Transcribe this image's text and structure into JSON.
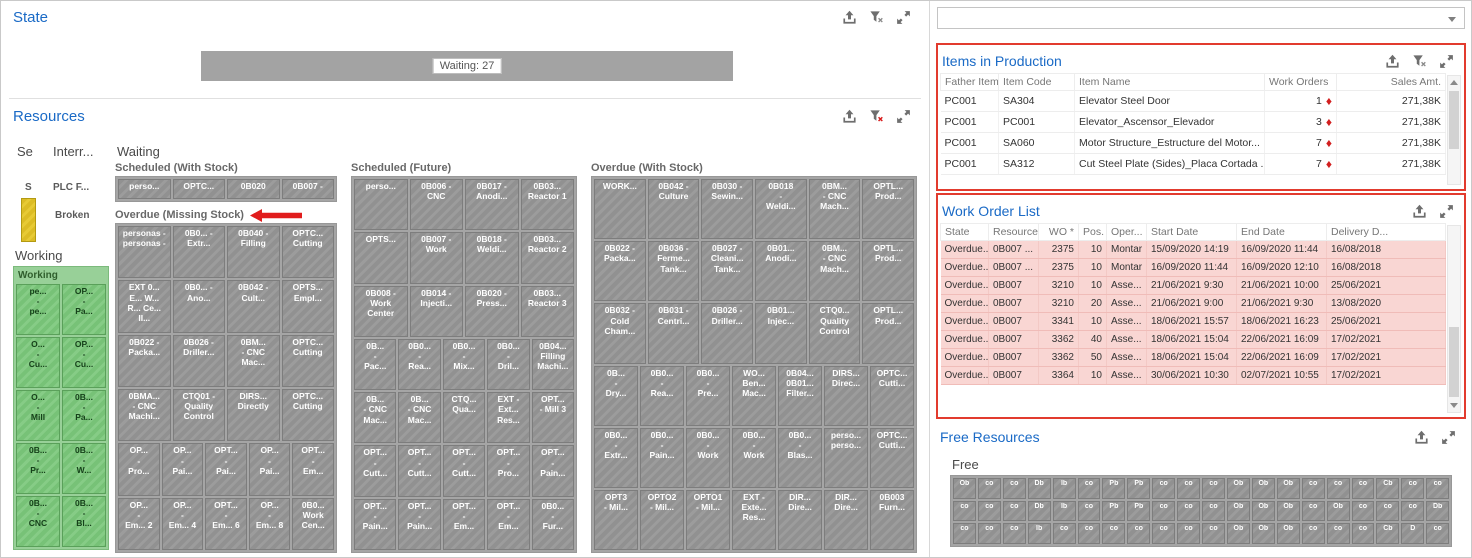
{
  "state_panel": {
    "title": "State",
    "icons": [
      "export-icon",
      "clear-filter-icon",
      "maximize-icon"
    ],
    "bar": {
      "label": "Waiting: 27",
      "status": "Waiting",
      "value": 27,
      "color": "#a3a3a3"
    }
  },
  "resources_panel": {
    "title": "Resources",
    "icons": [
      "export-icon",
      "clear-filter-red-icon",
      "maximize-icon"
    ],
    "section_labels": {
      "selected": "Se",
      "interrupted": "Interr...",
      "waiting": "Waiting",
      "working": "Working"
    },
    "selected_group": {
      "header": "S",
      "tile_color": "#e3c52a"
    },
    "interrupted_group": {
      "items": [
        "PLC F...",
        "Broken"
      ]
    },
    "working_group": {
      "label": "Working",
      "tile_rows": [
        [
          [
            "pe...",
            "-",
            "pe..."
          ],
          [
            "OP...",
            "-",
            "Pa..."
          ]
        ],
        [
          [
            "O...",
            "-",
            "Cu..."
          ],
          [
            "OP...",
            "-",
            "Cu..."
          ]
        ],
        [
          [
            "O...",
            "-",
            "Mill"
          ],
          [
            "0B...",
            "-",
            "Pa..."
          ]
        ],
        [
          [
            "0B...",
            "-",
            "Pr..."
          ],
          [
            "0B...",
            "-",
            "W..."
          ]
        ],
        [
          [
            "0B...",
            "-",
            "CNC"
          ],
          [
            "0B...",
            "-",
            "Bl..."
          ]
        ]
      ]
    },
    "waiting_groups": {
      "scheduled_with_stock": {
        "title": "Scheduled (With Stock)",
        "tile_rows": [
          [
            [
              "perso..."
            ],
            [
              "OPTC..."
            ],
            [
              "0B020"
            ],
            [
              "0B007 -"
            ]
          ]
        ]
      },
      "overdue_missing_stock": {
        "title": "Overdue (Missing Stock)",
        "tile_rows": [
          [
            [
              "personas -",
              "personas -"
            ],
            [
              "0B0... -",
              "Extr..."
            ],
            [
              "0B040 -",
              "Filling"
            ],
            [
              "OPTC...",
              "Cutting"
            ]
          ],
          [
            [
              "EXT 0...",
              "E... W...",
              "R... Ce...",
              "II..."
            ],
            [
              "0B0... -",
              "Ano..."
            ],
            [
              "0B042 -",
              "Cult..."
            ],
            [
              "OPTS...",
              "Empl..."
            ]
          ],
          [
            [
              "0B022 -",
              "Packa..."
            ],
            [
              "0B026 -",
              "Driller..."
            ],
            [
              "0BM...",
              "- CNC",
              "Mac..."
            ],
            [
              "OPTC...",
              "Cutting"
            ]
          ],
          [
            [
              "0BMA...",
              "- CNC",
              "Machi..."
            ],
            [
              "CTQ01 -",
              "Quality",
              "Control"
            ],
            [
              "DIRS...",
              "Directly"
            ],
            [
              "OPTC...",
              "Cutting"
            ]
          ],
          [
            [
              "OP...",
              "-",
              "Pro..."
            ],
            [
              "OP...",
              "-",
              "Pai..."
            ],
            [
              "OPT...",
              "-",
              "Pai..."
            ],
            [
              "OP...",
              "-",
              "Pai..."
            ],
            [
              "OPT...",
              "-",
              "Em..."
            ]
          ],
          [
            [
              "OP...",
              "-",
              "Em... 2"
            ],
            [
              "OP...",
              "-",
              "Em... 4"
            ],
            [
              "OPT...",
              "-",
              "Em... 6"
            ],
            [
              "OP...",
              "-",
              "Em... 8"
            ],
            [
              "0B0...",
              "Work",
              "Cen..."
            ]
          ]
        ]
      },
      "scheduled_future": {
        "title": "Scheduled (Future)",
        "tile_rows": [
          [
            [
              "perso..."
            ],
            [
              "0B006 -",
              "CNC"
            ],
            [
              "0B017 -",
              "Anodi..."
            ],
            [
              "0B03...",
              "Reactor 1"
            ]
          ],
          [
            [
              "OPTS..."
            ],
            [
              "0B007 -",
              "Work"
            ],
            [
              "0B018 -",
              "Weldi..."
            ],
            [
              "0B03...",
              "Reactor 2"
            ]
          ],
          [
            [
              "0B008 -",
              "Work",
              "Center"
            ],
            [
              "0B014 -",
              "Injecti..."
            ],
            [
              "0B020 -",
              "Press..."
            ],
            [
              "0B03...",
              "Reactor 3"
            ]
          ],
          [
            [
              "0B...",
              "-",
              "Pac..."
            ],
            [
              "0B0...",
              "-",
              "Rea..."
            ],
            [
              "0B0...",
              "-",
              "Mix..."
            ],
            [
              "0B0...",
              "-",
              "Dril..."
            ],
            [
              "0B04...",
              "Filling",
              "Machi..."
            ]
          ],
          [
            [
              "0B...",
              "- CNC",
              "Mac..."
            ],
            [
              "0B...",
              "- CNC",
              "Mac..."
            ],
            [
              "CTQ...",
              "Qua..."
            ],
            [
              "EXT -",
              "Ext...",
              "Res..."
            ],
            [
              "OPT...",
              "- Mill 3"
            ]
          ],
          [
            [
              "OPT...",
              "-",
              "Cutt..."
            ],
            [
              "OPT...",
              "-",
              "Cutt..."
            ],
            [
              "OPT...",
              "-",
              "Cutt..."
            ],
            [
              "OPT...",
              "-",
              "Pro..."
            ],
            [
              "OPT...",
              "-",
              "Pain..."
            ]
          ],
          [
            [
              "OPT...",
              "-",
              "Pain..."
            ],
            [
              "OPT...",
              "-",
              "Pain..."
            ],
            [
              "OPT...",
              "-",
              "Em..."
            ],
            [
              "OPT...",
              "-",
              "Em..."
            ],
            [
              "0B0...",
              "-",
              "Fur..."
            ]
          ]
        ]
      },
      "overdue_with_stock": {
        "title": "Overdue (With Stock)",
        "tile_rows": [
          [
            [
              "WORK..."
            ],
            [
              "0B042 -",
              "Culture"
            ],
            [
              "0B030 -",
              "Sewin..."
            ],
            [
              "0B018",
              "-",
              "Weldi..."
            ],
            [
              "0BM...",
              "- CNC",
              "Mach..."
            ],
            [
              "OPTL...",
              "Prod..."
            ]
          ],
          [
            [
              "0B022 -",
              "Packa..."
            ],
            [
              "0B036 -",
              "Ferme...",
              "Tank..."
            ],
            [
              "0B027 -",
              "Cleani...",
              "Tank..."
            ],
            [
              "0B01...",
              "Anodi..."
            ],
            [
              "0BM...",
              "- CNC",
              "Mach..."
            ],
            [
              "OPTL...",
              "Prod..."
            ]
          ],
          [
            [
              "0B032 -",
              "Cold",
              "Cham..."
            ],
            [
              "0B031 -",
              "Centri..."
            ],
            [
              "0B026 -",
              "Driller..."
            ],
            [
              "0B01...",
              "Injec..."
            ],
            [
              "CTQ0...",
              "Quality",
              "Control"
            ],
            [
              "OPTL...",
              "Prod..."
            ]
          ],
          [
            [
              "0B...",
              "-",
              "Dry..."
            ],
            [
              "0B0...",
              "-",
              "Rea..."
            ],
            [
              "0B0...",
              "-",
              "Pre..."
            ],
            [
              "WO...",
              "Ben...",
              "Mac..."
            ],
            [
              "0B04...",
              "0B01...",
              "Filter..."
            ],
            [
              "DIRS...",
              "Direc..."
            ],
            [
              "OPTC...",
              "Cutti..."
            ]
          ],
          [
            [
              "0B0...",
              "-",
              "Extr..."
            ],
            [
              "0B0...",
              "-",
              "Pain..."
            ],
            [
              "0B0...",
              "-",
              "Work"
            ],
            [
              "0B0...",
              "-",
              "Work"
            ],
            [
              "0B0...",
              "-",
              "Blas..."
            ],
            [
              "perso...",
              "perso..."
            ],
            [
              "OPTC...",
              "Cutti..."
            ]
          ],
          [
            [
              "OPT3",
              "- Mil..."
            ],
            [
              "OPTO2",
              "- Mil..."
            ],
            [
              "OPTO1",
              "- Mil..."
            ],
            [
              "EXT -",
              "Exte...",
              "Res..."
            ],
            [
              "DIR...",
              "Dire..."
            ],
            [
              "DIR...",
              "Dire..."
            ],
            [
              "0B003",
              "Furn..."
            ]
          ]
        ]
      }
    }
  },
  "filter_dropdown": {
    "value": ""
  },
  "items_in_production": {
    "title": "Items in Production",
    "icons": [
      "export-icon",
      "clear-filter-icon",
      "maximize-icon"
    ],
    "columns": [
      "Father Item",
      "Item Code",
      "Item Name",
      "Work Orders",
      "Sales Amt."
    ],
    "rows": [
      [
        "PC001",
        "SA304",
        "Elevator Steel Door",
        "1",
        "271,38K"
      ],
      [
        "PC001",
        "PC001",
        "Elevator_Ascensor_Elevador",
        "3",
        "271,38K"
      ],
      [
        "PC001",
        "SA060",
        "Motor Structure_Estructure del Motor...",
        "7",
        "271,38K"
      ],
      [
        "PC001",
        "SA312",
        "Cut Steel Plate (Sides)_Placa Cortada ...",
        "7",
        "271,38K"
      ]
    ],
    "indicator_color": "#d21f1f"
  },
  "work_order_list": {
    "title": "Work Order List",
    "icons": [
      "export-icon",
      "maximize-icon"
    ],
    "columns": [
      "State",
      "Resource",
      "WO *",
      "Pos.",
      "Oper...",
      "Start Date",
      "End Date",
      "Delivery D..."
    ],
    "rows": [
      [
        "Overdue...",
        "0B007 ...",
        "2375",
        "10",
        "Montar",
        "15/09/2020 14:19",
        "16/09/2020 11:44",
        "16/08/2018"
      ],
      [
        "Overdue...",
        "0B007 ...",
        "2375",
        "10",
        "Montar",
        "16/09/2020 11:44",
        "16/09/2020 12:10",
        "16/08/2018"
      ],
      [
        "Overdue...",
        "0B007",
        "3210",
        "10",
        "Asse...",
        "21/06/2021 9:30",
        "21/06/2021 10:00",
        "25/06/2021"
      ],
      [
        "Overdue...",
        "0B007",
        "3210",
        "20",
        "Asse...",
        "21/06/2021 9:00",
        "21/06/2021 9:30",
        "13/08/2020"
      ],
      [
        "Overdue...",
        "0B007",
        "3341",
        "10",
        "Asse...",
        "18/06/2021 15:57",
        "18/06/2021 16:23",
        "25/06/2021"
      ],
      [
        "Overdue...",
        "0B007",
        "3362",
        "40",
        "Asse...",
        "18/06/2021 15:04",
        "22/06/2021 16:09",
        "17/02/2021"
      ],
      [
        "Overdue...",
        "0B007",
        "3362",
        "50",
        "Asse...",
        "18/06/2021 15:04",
        "22/06/2021 16:09",
        "17/02/2021"
      ],
      [
        "Overdue...",
        "0B007",
        "3364",
        "10",
        "Asse...",
        "30/06/2021 10:30",
        "02/07/2021 10:55",
        "17/02/2021"
      ]
    ],
    "row_color": "#f9d6d3"
  },
  "free_resources": {
    "title": "Free Resources",
    "icons": [
      "export-icon",
      "maximize-icon"
    ],
    "group_label": "Free",
    "tile_rows": [
      [
        "Ob",
        "co",
        "co",
        "Db",
        "Ib",
        "co",
        "Pb",
        "Pb",
        "co",
        "co",
        "co",
        "Ob",
        "Ob",
        "Ob",
        "co",
        "co",
        "co",
        "Cb",
        "co",
        "co"
      ],
      [
        "co",
        "co",
        "co",
        "Db",
        "Ib",
        "co",
        "Pb",
        "Pb",
        "co",
        "co",
        "co",
        "Ob",
        "Ob",
        "Ob",
        "co",
        "Ob",
        "co",
        "co",
        "co",
        "Db"
      ],
      [
        "co",
        "co",
        "co",
        "Ib",
        "co",
        "co",
        "co",
        "co",
        "co",
        "co",
        "co",
        "Ob",
        "Ob",
        "Ob",
        "co",
        "co",
        "co",
        "Cb",
        "D",
        "co"
      ]
    ]
  }
}
